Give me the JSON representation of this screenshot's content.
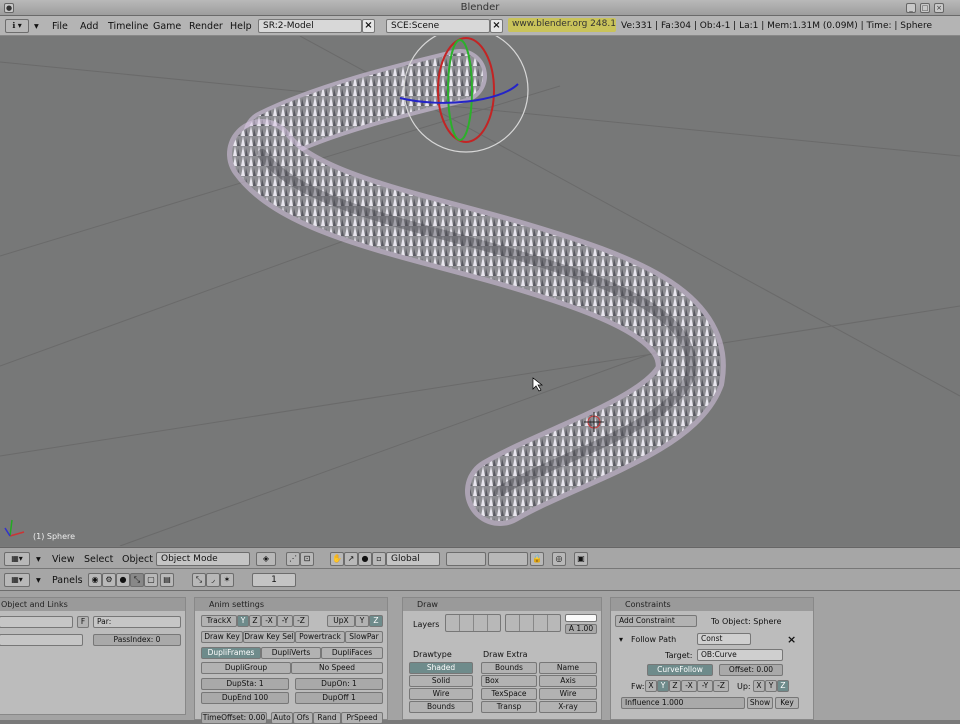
{
  "window": {
    "title": "Blender"
  },
  "menubar": {
    "menus": [
      "File",
      "Add",
      "Timeline",
      "Game",
      "Render",
      "Help"
    ],
    "screen_field": "SR:2-Model",
    "scene_field": "SCE:Scene",
    "site": "www.blender.org 248.1",
    "stats": "Ve:331 | Fa:304 | Ob:4-1 | La:1 | Mem:1.31M (0.09M) | Time: | Sphere"
  },
  "viewport": {
    "object_info": "(1) Sphere"
  },
  "view3d_header": {
    "menus": [
      "View",
      "Select",
      "Object"
    ],
    "mode": "Object Mode",
    "orientation": "Global"
  },
  "buttons_header": {
    "panels_label": "Panels",
    "frame": "1"
  },
  "panel_object": {
    "title": "Object and Links",
    "par_label": "Par:",
    "f_label": "F",
    "pass_index": "PassIndex: 0"
  },
  "panel_anim": {
    "title": "Anim settings",
    "track": [
      "TrackX",
      "Y",
      "Z",
      "-X",
      "-Y",
      "-Z"
    ],
    "up": [
      "UpX",
      "Y",
      "Z"
    ],
    "row2": [
      "Draw Key",
      "Draw Key Sel",
      "Powertrack",
      "SlowPar"
    ],
    "dupli": [
      "DupliFrames",
      "DupliVerts",
      "DupliFaces"
    ],
    "dupligroup": "DupliGroup",
    "nospeed": "No Speed",
    "dupsta": "DupSta: 1",
    "dupon": "DupOn: 1",
    "dupend": "DupEnd 100",
    "dupoff": "DupOff 1",
    "timeoffset": "TimeOffset: 0.00",
    "bottom": [
      "Auto",
      "Ofs",
      "Rand",
      "PrSpeed"
    ]
  },
  "panel_draw": {
    "title": "Draw",
    "layers_label": "Layers",
    "alpha": "A 1.00",
    "drawtype_label": "Drawtype",
    "drawextra_label": "Draw Extra",
    "drawtype": [
      "Shaded",
      "Solid",
      "Wire",
      "Bounds"
    ],
    "extra_left": [
      "Bounds",
      "Box",
      "TexSpace",
      "Transp"
    ],
    "extra_right": [
      "Name",
      "Axis",
      "Wire",
      "X-ray"
    ]
  },
  "panel_constraints": {
    "title": "Constraints",
    "add": "Add Constraint",
    "to_object": "To Object: Sphere",
    "follow_path": "Follow Path",
    "const": "Const",
    "target_label": "Target:",
    "target": "OB:Curve",
    "curvefollow": "CurveFollow",
    "offset": "Offset: 0.00",
    "fw_label": "Fw:",
    "fw": [
      "X",
      "Y",
      "Z",
      "-X",
      "-Y",
      "-Z"
    ],
    "up_label": "Up:",
    "up": [
      "X",
      "Y",
      "Z"
    ],
    "influence": "Influence 1.000",
    "show": "Show",
    "key": "Key"
  }
}
